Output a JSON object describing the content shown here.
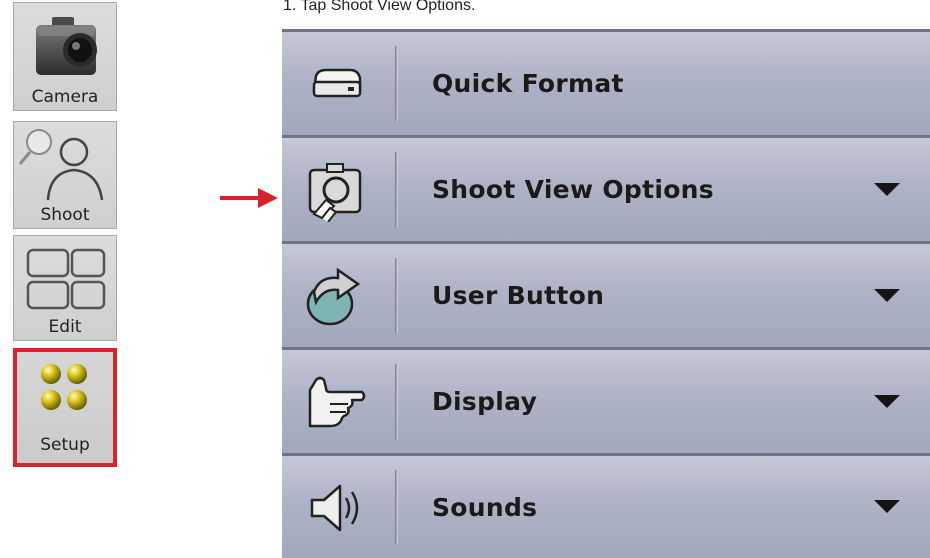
{
  "instruction": "1. Tap Shoot View Options.",
  "tools": [
    {
      "label": "Camera",
      "icon": "camera-icon"
    },
    {
      "label": "Shoot",
      "icon": "person-icon"
    },
    {
      "label": "Edit",
      "icon": "edit-panels-icon"
    },
    {
      "label": "Setup",
      "icon": "setup-dots-icon",
      "selected": true
    }
  ],
  "menu": [
    {
      "label": "Quick Format",
      "icon": "drive-icon",
      "has_dropdown": false
    },
    {
      "label": "Shoot View Options",
      "icon": "shoot-view-icon",
      "has_dropdown": true
    },
    {
      "label": "User Button",
      "icon": "user-button-icon",
      "has_dropdown": true
    },
    {
      "label": "Display",
      "icon": "pointing-hand-icon",
      "has_dropdown": true
    },
    {
      "label": "Sounds",
      "icon": "speaker-icon",
      "has_dropdown": true
    }
  ],
  "colors": {
    "highlight_border": "#d5242f",
    "arrow": "#d5242f",
    "menu_row": "#aeb3c6"
  }
}
